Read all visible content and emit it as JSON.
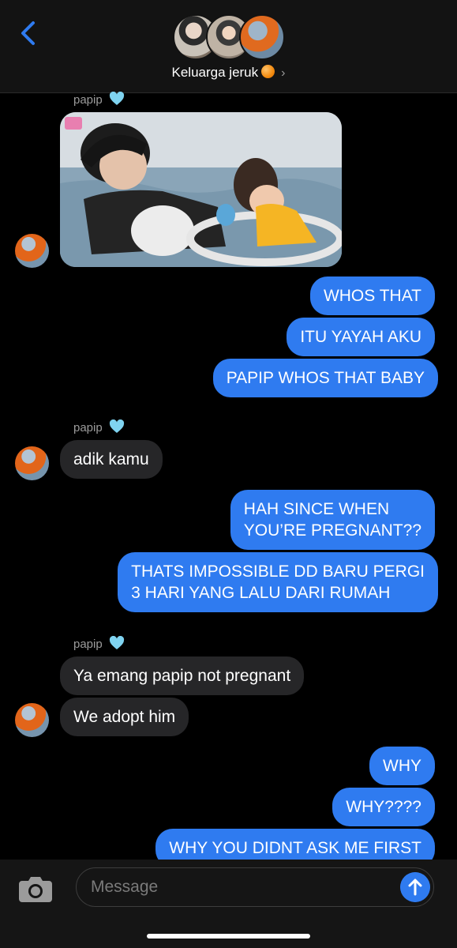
{
  "header": {
    "title": "Keluarga jeruk",
    "chevron": "›"
  },
  "sender_name": "papip",
  "messages": {
    "m1": "WHOS THAT",
    "m2": "ITU YAYAH AKU",
    "m3": "PAPIP WHOS THAT BABY",
    "m4": "adik kamu",
    "m5_line1": "HAH SINCE WHEN",
    "m5_line2": "YOU’RE PREGNANT??",
    "m6_line1": "THATS IMPOSSIBLE DD BARU PERGI",
    "m6_line2": "3 HARI YANG LALU DARI RUMAH",
    "m7": "Ya emang papip not pregnant",
    "m8": "We adopt him",
    "m9": "WHY",
    "m10": "WHY????",
    "m11": "WHY YOU DIDNT ASK ME FIRST"
  },
  "composer": {
    "placeholder": "Message"
  },
  "colors": {
    "outgoing_bubble": "#2f7bf0",
    "incoming_bubble": "#262628",
    "background": "#000000",
    "accent": "#2f7bf0"
  },
  "icons": [
    "back-chevron-icon",
    "orange-emoji-icon",
    "chevron-right-icon",
    "blue-heart-icon",
    "camera-icon",
    "send-arrow-icon"
  ]
}
